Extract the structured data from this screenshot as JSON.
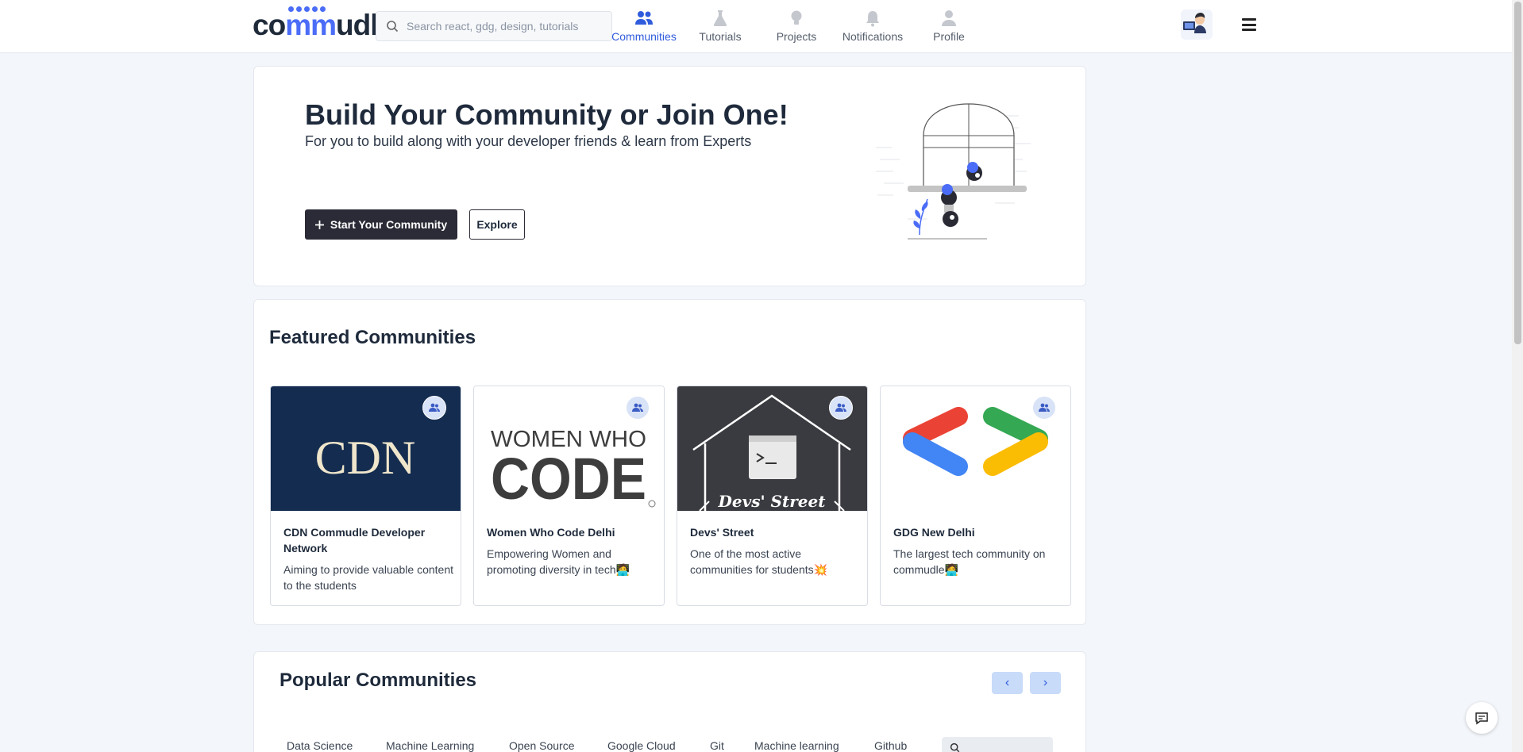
{
  "header": {
    "logo": {
      "pre": "co",
      "mm": "mm",
      "post": "udle"
    },
    "search_placeholder": "Search react, gdg, design, tutorials",
    "nav": [
      {
        "label": "Communities",
        "icon": "users-icon",
        "active": true
      },
      {
        "label": "Tutorials",
        "icon": "flask-icon",
        "active": false
      },
      {
        "label": "Projects",
        "icon": "lightbulb-icon",
        "active": false
      },
      {
        "label": "Notifications",
        "icon": "bell-icon",
        "active": false
      },
      {
        "label": "Profile",
        "icon": "user-icon",
        "active": false
      }
    ]
  },
  "hero": {
    "title": "Build Your Community or Join One!",
    "subtitle": "For you to build along with your developer friends & learn from Experts",
    "primary_button": "Start Your Community",
    "secondary_button": "Explore"
  },
  "featured": {
    "title": "Featured Communities",
    "communities": [
      {
        "name": "CDN Commudle Developer Network",
        "description": "Aiming to provide valuable content to the students",
        "image_text": "CDN"
      },
      {
        "name": "Women Who Code Delhi",
        "description": "Empowering Women and promoting diversity in tech🧑‍💻",
        "image_text_top": "WOMEN WHO",
        "image_text_bottom": "CODE"
      },
      {
        "name": "Devs' Street",
        "description": "One of the most active communities for students💥",
        "image_text": "Devs' Street"
      },
      {
        "name": "GDG New Delhi",
        "description": "The largest tech community on commudle🧑‍💻"
      }
    ]
  },
  "popular": {
    "title": "Popular Communities",
    "prev_label": "‹",
    "next_label": "›",
    "tags": [
      "Data Science",
      "Machine Learning",
      "Open Source",
      "Google Cloud",
      "Git",
      "Machine learning",
      "Github"
    ]
  },
  "colors": {
    "accent": "#2f5bdc",
    "brand_blue": "#4a6cf7",
    "dark_button": "#2a2b36",
    "cdn_navy": "#142c4f",
    "devs_dark": "#3a3b40"
  }
}
